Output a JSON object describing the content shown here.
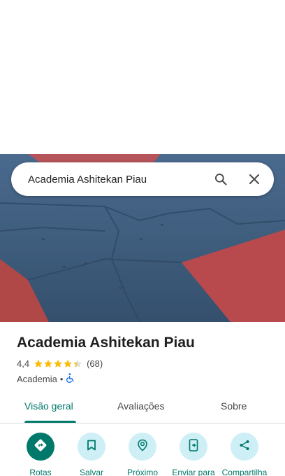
{
  "search": {
    "query": "Academia Ashitekan Piau"
  },
  "place": {
    "title": "Academia Ashitekan Piau",
    "rating": "4,4",
    "stars": 4.4,
    "reviews_count": "(68)",
    "category": "Academia",
    "separator": "•"
  },
  "tabs": [
    {
      "label": "Visão geral",
      "active": true
    },
    {
      "label": "Avaliações",
      "active": false
    },
    {
      "label": "Sobre",
      "active": false
    }
  ],
  "actions": [
    {
      "label": "Rotas",
      "icon": "directions-icon"
    },
    {
      "label": "Salvar",
      "icon": "bookmark-icon"
    },
    {
      "label": "Próximo",
      "icon": "nearby-icon"
    },
    {
      "label": "Enviar para",
      "icon": "send-to-phone-icon"
    },
    {
      "label": "Compartilha",
      "icon": "share-icon"
    }
  ],
  "colors": {
    "accent": "#00796b",
    "action_bg": "#cdeff5",
    "star": "#fbbc04",
    "mat_blue": "#3d5a7a",
    "mat_red": "#b44a4e"
  }
}
